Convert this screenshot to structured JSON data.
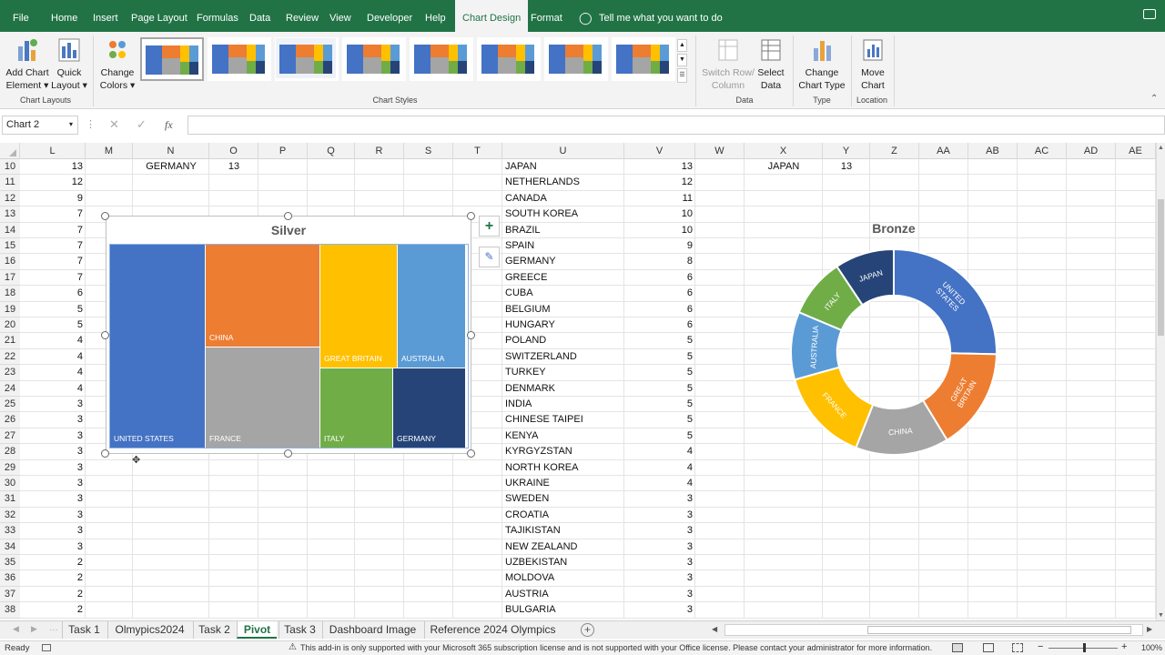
{
  "menu": [
    "File",
    "Home",
    "Insert",
    "Page Layout",
    "Formulas",
    "Data",
    "Review",
    "View",
    "Developer",
    "Help",
    "Chart Design",
    "Format"
  ],
  "menu_active": "Chart Design",
  "tell_me": "Tell me what you want to do",
  "ribbon": {
    "add_chart_element": [
      "Add Chart",
      "Element ▾"
    ],
    "quick_layout": [
      "Quick",
      "Layout ▾"
    ],
    "change_colors": [
      "Change",
      "Colors ▾"
    ],
    "chart_layouts_label": "Chart Layouts",
    "chart_styles_label": "Chart Styles",
    "switch_row_col": [
      "Switch Row/",
      "Column"
    ],
    "select_data": [
      "Select",
      "Data"
    ],
    "data_label": "Data",
    "change_chart_type": [
      "Change",
      "Chart Type"
    ],
    "type_label": "Type",
    "move_chart": [
      "Move",
      "Chart"
    ],
    "location_label": "Location"
  },
  "name_box": "Chart 2",
  "fx_symbol": "fx",
  "columns": [
    "L",
    "M",
    "N",
    "O",
    "P",
    "Q",
    "R",
    "S",
    "T",
    "U",
    "V",
    "W",
    "X",
    "Y",
    "Z",
    "AA",
    "AB",
    "AC",
    "AD",
    "AE"
  ],
  "rows": [
    10,
    11,
    12,
    13,
    14,
    15,
    16,
    17,
    18,
    19,
    20,
    21,
    22,
    23,
    24,
    25,
    26,
    27,
    28,
    29,
    30,
    31,
    32,
    33,
    34,
    35,
    36,
    37,
    38
  ],
  "col_L": [
    13,
    12,
    9,
    7,
    7,
    7,
    7,
    7,
    6,
    5,
    5,
    4,
    4,
    4,
    4,
    3,
    3,
    3,
    3,
    3,
    3,
    3,
    3,
    3,
    3,
    2,
    2,
    2,
    2
  ],
  "n_label": "GERMANY",
  "o_value": "13",
  "x_label": "JAPAN",
  "y_value": "13",
  "country_list": [
    [
      "JAPAN",
      13
    ],
    [
      "NETHERLANDS",
      12
    ],
    [
      "CANADA",
      11
    ],
    [
      "SOUTH KOREA",
      10
    ],
    [
      "BRAZIL",
      10
    ],
    [
      "SPAIN",
      9
    ],
    [
      "GERMANY",
      8
    ],
    [
      "GREECE",
      6
    ],
    [
      "CUBA",
      6
    ],
    [
      "BELGIUM",
      6
    ],
    [
      "HUNGARY",
      6
    ],
    [
      "POLAND",
      5
    ],
    [
      "SWITZERLAND",
      5
    ],
    [
      "TURKEY",
      5
    ],
    [
      "DENMARK",
      5
    ],
    [
      "INDIA",
      5
    ],
    [
      "CHINESE TAIPEI",
      5
    ],
    [
      "KENYA",
      5
    ],
    [
      "KYRGYZSTAN",
      4
    ],
    [
      "NORTH KOREA",
      4
    ],
    [
      "UKRAINE",
      4
    ],
    [
      "SWEDEN",
      3
    ],
    [
      "CROATIA",
      3
    ],
    [
      "TAJIKISTAN",
      3
    ],
    [
      "NEW ZEALAND",
      3
    ],
    [
      "UZBEKISTAN",
      3
    ],
    [
      "MOLDOVA",
      3
    ],
    [
      "AUSTRIA",
      3
    ],
    [
      "BULGARIA",
      3
    ]
  ],
  "treemap": {
    "title": "Silver",
    "labels": [
      "UNITED STATES",
      "CHINA",
      "FRANCE",
      "GREAT BRITAIN",
      "AUSTRALIA",
      "ITALY",
      "GERMANY"
    ],
    "colors": [
      "#4472c4",
      "#ed7d31",
      "#a5a5a5",
      "#ffc000",
      "#5b9bd5",
      "#70ad47",
      "#264478"
    ]
  },
  "chart_data": {
    "type": "pie",
    "title": "Bronze",
    "categories": [
      "UNITED STATES",
      "GREAT BRITAIN",
      "CHINA",
      "FRANCE",
      "AUSTRALIA",
      "ITALY",
      "JAPAN"
    ],
    "values": [
      19,
      12,
      11,
      11,
      8,
      7,
      7
    ],
    "colors": [
      "#4472c4",
      "#ed7d31",
      "#a5a5a5",
      "#ffc000",
      "#5b9bd5",
      "#70ad47",
      "#264478"
    ],
    "hole": 0.55
  },
  "sheet_tabs": [
    "Task 1",
    "Olmypics2024",
    "Task 2",
    "Pivot",
    "Task 3",
    "Dashboard Image",
    "Reference 2024 Olympics"
  ],
  "active_tab": "Pivot",
  "status": {
    "ready": "Ready",
    "message": "This add-in is only supported with your Microsoft 365 subscription license and is not supported with your Office license. Please contact your administrator for more information.",
    "zoom": "100%"
  }
}
